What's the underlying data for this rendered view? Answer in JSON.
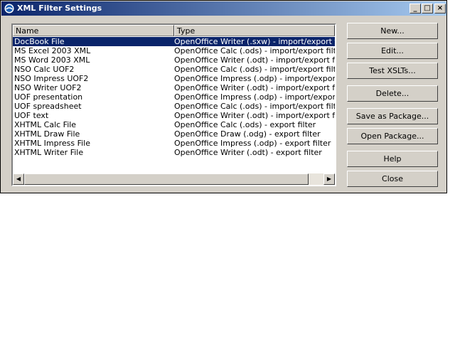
{
  "window": {
    "title": "XML Filter Settings",
    "controls": {
      "minimize": "_",
      "maximize": "□",
      "close": "×"
    }
  },
  "list": {
    "columns": {
      "name": "Name",
      "type": "Type"
    },
    "selected_index": 0,
    "rows": [
      {
        "name": "DocBook File",
        "type": "OpenOffice Writer (.sxw) - import/export filter"
      },
      {
        "name": "MS Excel 2003 XML",
        "type": "OpenOffice Calc (.ods) - import/export filter"
      },
      {
        "name": "MS Word 2003 XML",
        "type": "OpenOffice Writer (.odt) - import/export filter"
      },
      {
        "name": "NSO Calc UOF2",
        "type": "OpenOffice Calc (.ods) - import/export filter"
      },
      {
        "name": "NSO Impress UOF2",
        "type": "OpenOffice Impress (.odp) - import/export filter"
      },
      {
        "name": "NSO Writer UOF2",
        "type": "OpenOffice Writer (.odt) - import/export filter"
      },
      {
        "name": "UOF presentation",
        "type": "OpenOffice Impress (.odp) - import/export filter"
      },
      {
        "name": "UOF spreadsheet",
        "type": "OpenOffice Calc (.ods) - import/export filter"
      },
      {
        "name": "UOF text",
        "type": "OpenOffice Writer (.odt) - import/export filter"
      },
      {
        "name": "XHTML Calc File",
        "type": "OpenOffice Calc (.ods) - export filter"
      },
      {
        "name": "XHTML Draw File",
        "type": "OpenOffice Draw (.odg) - export filter"
      },
      {
        "name": "XHTML Impress File",
        "type": "OpenOffice Impress (.odp) - export filter"
      },
      {
        "name": "XHTML Writer File",
        "type": "OpenOffice Writer (.odt) - export filter"
      }
    ],
    "scrollbar": {
      "left_arrow": "◀",
      "right_arrow": "▶"
    }
  },
  "buttons": {
    "new": "New...",
    "edit": "Edit...",
    "test_xslts": "Test XSLTs...",
    "delete": "Delete...",
    "save_as_package": "Save as Package...",
    "open_package": "Open Package...",
    "help": "Help",
    "close": "Close"
  },
  "colors": {
    "face": "#d4d0c8",
    "title_start": "#0a246a",
    "title_end": "#a6caf0",
    "selection": "#0a246a"
  }
}
